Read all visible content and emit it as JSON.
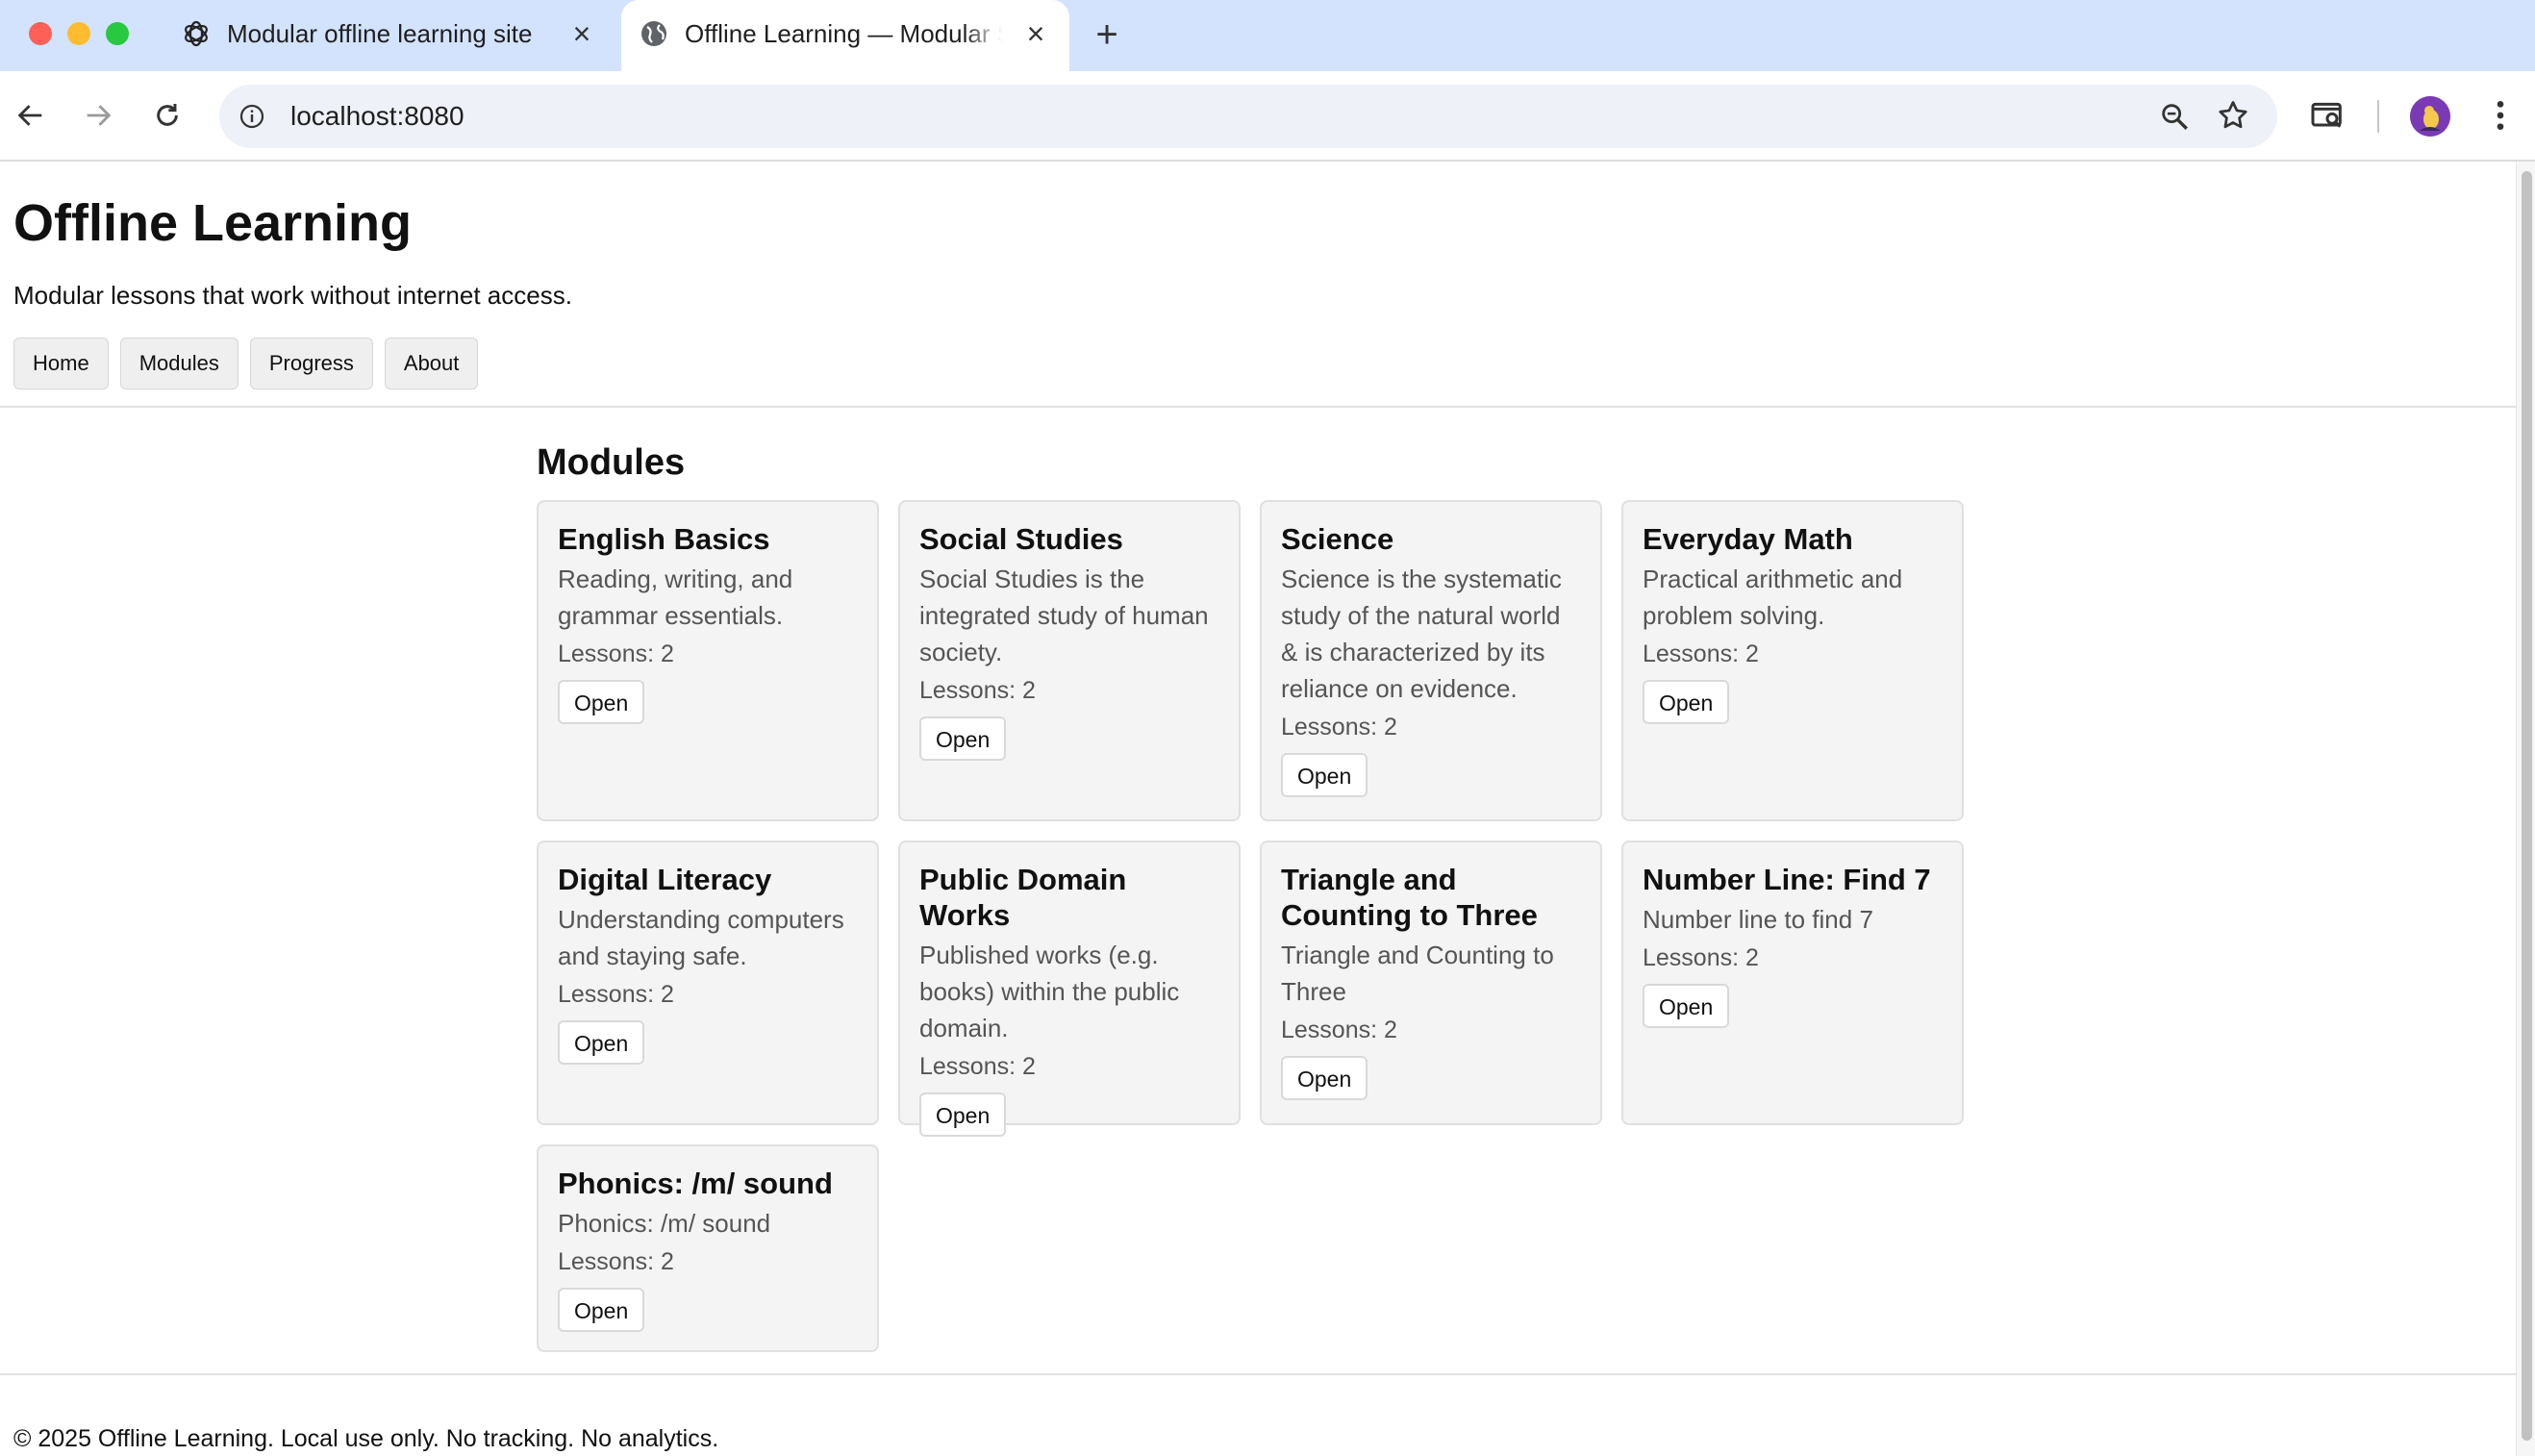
{
  "browser": {
    "tabs": [
      {
        "title": "Modular offline learning site",
        "icon": "openai-icon",
        "active": false
      },
      {
        "title": "Offline Learning — Modular Site",
        "icon": "globe-icon",
        "active": true
      }
    ],
    "url": "localhost:8080"
  },
  "site": {
    "title": "Offline Learning",
    "subtitle": "Modular lessons that work without internet access.",
    "nav": [
      "Home",
      "Modules",
      "Progress",
      "About"
    ]
  },
  "main": {
    "heading": "Modules",
    "open_label": "Open",
    "modules": [
      {
        "title": "English Basics",
        "description": "Reading, writing, and grammar essentials.",
        "lessons": "Lessons: 2"
      },
      {
        "title": "Social Studies",
        "description": "Social Studies is the integrated study of human society.",
        "lessons": "Lessons: 2"
      },
      {
        "title": "Science",
        "description": "Science is the systematic study of the natural world & is characterized by its reliance on evidence.",
        "lessons": "Lessons: 2"
      },
      {
        "title": "Everyday Math",
        "description": "Practical arithmetic and problem solving.",
        "lessons": "Lessons: 2"
      },
      {
        "title": "Digital Literacy",
        "description": "Understanding computers and staying safe.",
        "lessons": "Lessons: 2"
      },
      {
        "title": "Public Domain Works",
        "description": "Published works (e.g. books) within the public domain.",
        "lessons": "Lessons: 2"
      },
      {
        "title": "Triangle and Counting to Three",
        "description": "Triangle and Counting to Three",
        "lessons": "Lessons: 2"
      },
      {
        "title": "Number Line: Find 7",
        "description": "Number line to find 7",
        "lessons": "Lessons: 2"
      },
      {
        "title": "Phonics: /m/ sound",
        "description": "Phonics: /m/ sound",
        "lessons": "Lessons: 2"
      }
    ]
  },
  "footer": {
    "text": "© 2025 Offline Learning. Local use only. No tracking. No analytics."
  }
}
